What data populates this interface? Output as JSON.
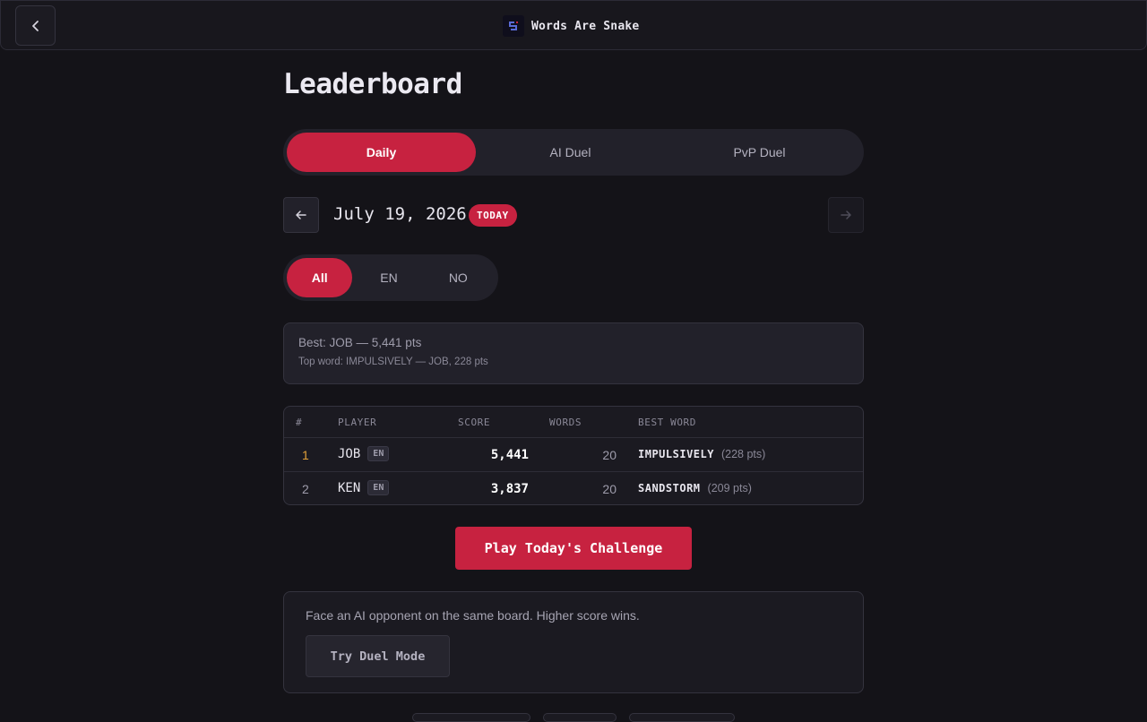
{
  "header": {
    "app_title": "Words Are Snake"
  },
  "page": {
    "title": "Leaderboard"
  },
  "mode_tabs": [
    {
      "label": "Daily",
      "active": true
    },
    {
      "label": "AI Duel",
      "active": false
    },
    {
      "label": "PvP Duel",
      "active": false
    }
  ],
  "date_nav": {
    "date": "July 19, 2026",
    "badge": "TODAY",
    "prev_icon": "arrow-left-icon",
    "next_icon": "arrow-right-icon",
    "next_disabled": true
  },
  "lang_tabs": [
    {
      "label": "All",
      "active": true
    },
    {
      "label": "EN",
      "active": false
    },
    {
      "label": "NO",
      "active": false
    }
  ],
  "summary": {
    "best": "Best: JOB — 5,441 pts",
    "top_word": "Top word: IMPULSIVELY — JOB, 228 pts"
  },
  "table": {
    "headers": [
      "#",
      "PLAYER",
      "SCORE",
      "WORDS",
      "BEST WORD"
    ],
    "rows": [
      {
        "rank": "1",
        "player": "JOB",
        "lang": "EN",
        "score": "5,441",
        "words": "20",
        "best_word": "IMPULSIVELY",
        "best_pts": "(228 pts)"
      },
      {
        "rank": "2",
        "player": "KEN",
        "lang": "EN",
        "score": "3,837",
        "words": "20",
        "best_word": "SANDSTORM",
        "best_pts": "(209 pts)"
      }
    ]
  },
  "cta": {
    "play_label": "Play Today's Challenge"
  },
  "duel_card": {
    "text": "Face an AI opponent on the same board. Higher score wins.",
    "button_label": "Try Duel Mode"
  },
  "colors": {
    "accent": "#c72240",
    "background": "#141318",
    "surface": "#22212a",
    "gold": "#e2a13a"
  }
}
